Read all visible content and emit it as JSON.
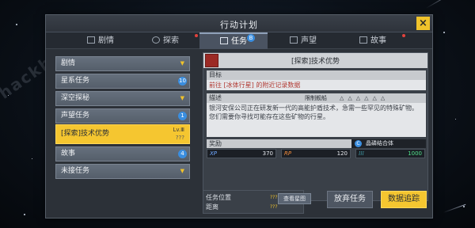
{
  "window": {
    "title": "行动计划",
    "close_icon": "×"
  },
  "tabs": [
    {
      "label": "剧情",
      "icon": "book-icon"
    },
    {
      "label": "探索",
      "icon": "compass-icon"
    },
    {
      "label": "任务",
      "icon": "clipboard-icon",
      "badge": "B"
    },
    {
      "label": "声望",
      "icon": "flag-icon"
    },
    {
      "label": "故事",
      "icon": "story-icon"
    }
  ],
  "quest_list": [
    {
      "label": "剧情"
    },
    {
      "label": "星系任务",
      "badge": "10"
    },
    {
      "label": "深空探秘"
    },
    {
      "label": "声望任务",
      "badge": "1"
    },
    {
      "label": "[探索]技术优势",
      "level": "Lv.Ⅲ",
      "level_sub": "???"
    },
    {
      "label": "故事",
      "badge": "4"
    },
    {
      "label": "未接任务"
    }
  ],
  "detail": {
    "title": "[探索]技术优势",
    "objective_label": "目标",
    "objective_text": "前往 [冰体行星] 的附近记录数据",
    "desc_label": "描述",
    "difficulty_label": "限制舰船",
    "description": "银河安保公司正在研发新一代的高能护盾技术，急需一些罕见的特殊矿物。您们需要你寻找可能存在这些矿物的行星。",
    "reward_label": "奖励",
    "material": "晶磷结合体",
    "rewards": [
      {
        "key": "XP",
        "value": "370"
      },
      {
        "key": "RP",
        "value": "120"
      },
      {
        "key": "",
        "value": "1000"
      }
    ]
  },
  "footer": {
    "location_label": "任务位置",
    "distance_label": "距离",
    "location_value": "???",
    "distance_value": "???",
    "map_button": "查看星图",
    "abandon_button": "放弃任务",
    "track_button": "数据追踪"
  },
  "watermark": "hackhome",
  "colors": {
    "accent": "#f5c630",
    "badge": "#3a8ee0",
    "alert": "#e2423c"
  }
}
